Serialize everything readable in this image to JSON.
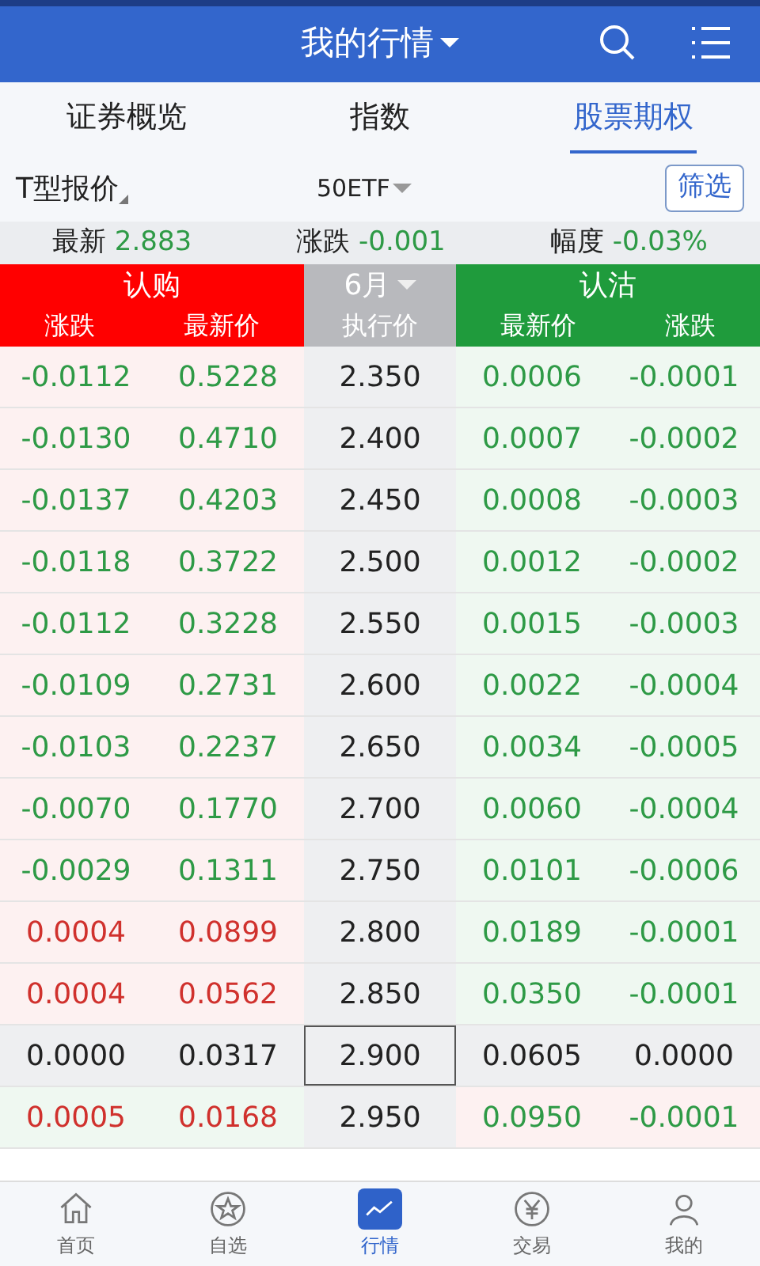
{
  "header": {
    "title": "我的行情"
  },
  "tabs": [
    {
      "label": "证券概览",
      "selected": false
    },
    {
      "label": "指数",
      "selected": false
    },
    {
      "label": "股票期权",
      "selected": true
    }
  ],
  "toolbar": {
    "mode": "T型报价",
    "underlying": "50ETF",
    "filter_button": "筛选"
  },
  "quote": [
    {
      "label": "最新",
      "value": "2.883"
    },
    {
      "label": "涨跌",
      "value": "-0.001"
    },
    {
      "label": "幅度",
      "value": "-0.03%"
    }
  ],
  "table_header": {
    "call": "认购",
    "month": "6月",
    "put": "认沽",
    "columns": [
      "涨跌",
      "最新价",
      "执行价",
      "最新价",
      "涨跌"
    ]
  },
  "rows": [
    {
      "kind": "itm",
      "call": {
        "change": "-0.0112",
        "price": "0.5228",
        "color": "#2e9a46"
      },
      "strike": "2.350",
      "put": {
        "price": "0.0006",
        "change": "-0.0001",
        "color": "#2e9a46"
      }
    },
    {
      "kind": "itm",
      "call": {
        "change": "-0.0130",
        "price": "0.4710",
        "color": "#2e9a46"
      },
      "strike": "2.400",
      "put": {
        "price": "0.0007",
        "change": "-0.0002",
        "color": "#2e9a46"
      }
    },
    {
      "kind": "itm",
      "call": {
        "change": "-0.0137",
        "price": "0.4203",
        "color": "#2e9a46"
      },
      "strike": "2.450",
      "put": {
        "price": "0.0008",
        "change": "-0.0003",
        "color": "#2e9a46"
      }
    },
    {
      "kind": "itm",
      "call": {
        "change": "-0.0118",
        "price": "0.3722",
        "color": "#2e9a46"
      },
      "strike": "2.500",
      "put": {
        "price": "0.0012",
        "change": "-0.0002",
        "color": "#2e9a46"
      }
    },
    {
      "kind": "itm",
      "call": {
        "change": "-0.0112",
        "price": "0.3228",
        "color": "#2e9a46"
      },
      "strike": "2.550",
      "put": {
        "price": "0.0015",
        "change": "-0.0003",
        "color": "#2e9a46"
      }
    },
    {
      "kind": "itm",
      "call": {
        "change": "-0.0109",
        "price": "0.2731",
        "color": "#2e9a46"
      },
      "strike": "2.600",
      "put": {
        "price": "0.0022",
        "change": "-0.0004",
        "color": "#2e9a46"
      }
    },
    {
      "kind": "itm",
      "call": {
        "change": "-0.0103",
        "price": "0.2237",
        "color": "#2e9a46"
      },
      "strike": "2.650",
      "put": {
        "price": "0.0034",
        "change": "-0.0005",
        "color": "#2e9a46"
      }
    },
    {
      "kind": "itm",
      "call": {
        "change": "-0.0070",
        "price": "0.1770",
        "color": "#2e9a46"
      },
      "strike": "2.700",
      "put": {
        "price": "0.0060",
        "change": "-0.0004",
        "color": "#2e9a46"
      }
    },
    {
      "kind": "itm",
      "call": {
        "change": "-0.0029",
        "price": "0.1311",
        "color": "#2e9a46"
      },
      "strike": "2.750",
      "put": {
        "price": "0.0101",
        "change": "-0.0006",
        "color": "#2e9a46"
      }
    },
    {
      "kind": "itm",
      "call": {
        "change": "0.0004",
        "price": "0.0899",
        "color": "#d0312d"
      },
      "strike": "2.800",
      "put": {
        "price": "0.0189",
        "change": "-0.0001",
        "color": "#2e9a46"
      }
    },
    {
      "kind": "itm",
      "call": {
        "change": "0.0004",
        "price": "0.0562",
        "color": "#d0312d"
      },
      "strike": "2.850",
      "put": {
        "price": "0.0350",
        "change": "-0.0001",
        "color": "#2e9a46"
      }
    },
    {
      "kind": "atm",
      "call": {
        "change": "0.0000",
        "price": "0.0317",
        "color": "#222222"
      },
      "strike": "2.900",
      "put": {
        "price": "0.0605",
        "change": "0.0000",
        "color": "#222222"
      }
    },
    {
      "kind": "otm",
      "call": {
        "change": "0.0005",
        "price": "0.0168",
        "color": "#d0312d"
      },
      "strike": "2.950",
      "put": {
        "price": "0.0950",
        "change": "-0.0001",
        "color": "#2e9a46"
      }
    }
  ],
  "bottom_nav": [
    {
      "label": "首页",
      "selected": false
    },
    {
      "label": "自选",
      "selected": false
    },
    {
      "label": "行情",
      "selected": true
    },
    {
      "label": "交易",
      "selected": false
    },
    {
      "label": "我的",
      "selected": false
    }
  ]
}
